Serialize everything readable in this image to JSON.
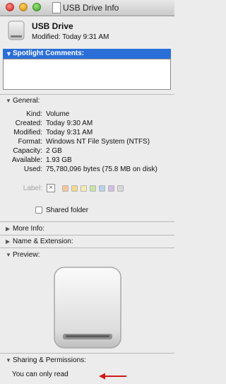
{
  "window": {
    "title": "USB Drive Info"
  },
  "header": {
    "name": "USB Drive",
    "modified": "Modified: Today 9:31 AM"
  },
  "spotlight": {
    "heading": "Spotlight Comments:",
    "value": ""
  },
  "general": {
    "heading": "General:",
    "kind_k": "Kind:",
    "kind_v": "Volume",
    "created_k": "Created:",
    "created_v": "Today 9:30 AM",
    "modified_k": "Modified:",
    "modified_v": "Today 9:31 AM",
    "format_k": "Format:",
    "format_v": "Windows NT File System (NTFS)",
    "capacity_k": "Capacity:",
    "capacity_v": "2 GB",
    "available_k": "Available:",
    "available_v": "1.93 GB",
    "used_k": "Used:",
    "used_v": "75,780,096 bytes (75.8 MB on disk)",
    "label_k": "Label:",
    "label_colors": [
      "#f6c59b",
      "#f5d98a",
      "#f3ecb0",
      "#c8e3a8",
      "#b7d2ef",
      "#d2c0e6",
      "#d8d8d8"
    ],
    "shared_folder": "Shared folder"
  },
  "more_info": "More Info:",
  "name_ext": "Name & Extension:",
  "preview": "Preview:",
  "sharing": {
    "heading": "Sharing & Permissions:",
    "status": "You can only read"
  }
}
